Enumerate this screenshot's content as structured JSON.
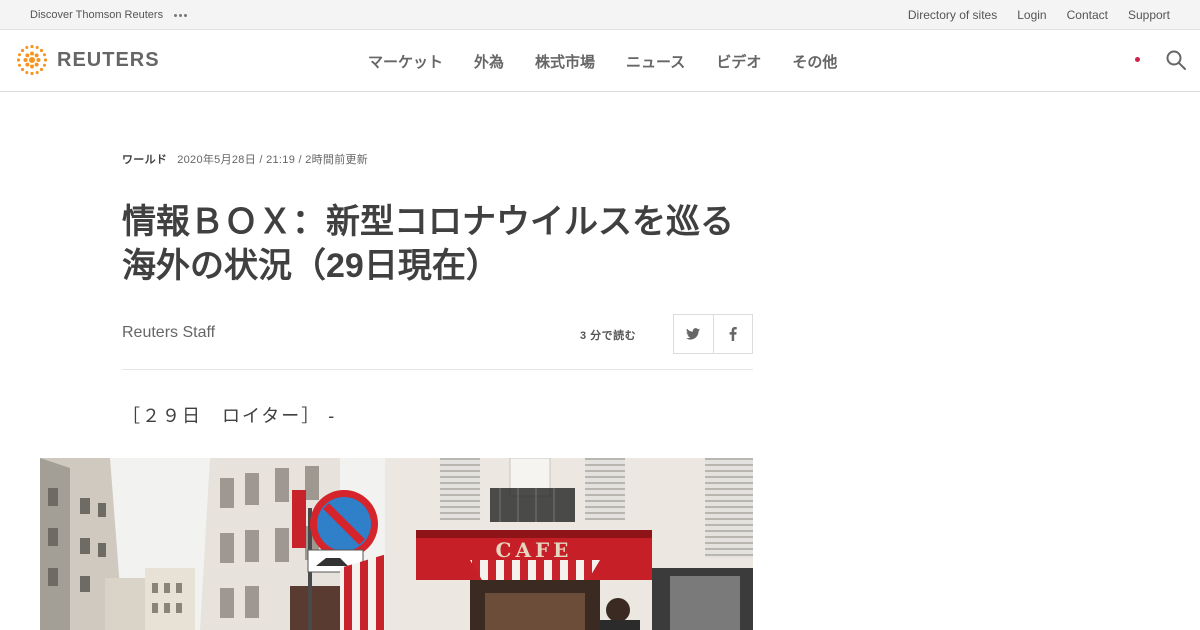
{
  "utility_bar": {
    "discover": "Discover Thomson Reuters",
    "links": [
      "Directory of sites",
      "Login",
      "Contact",
      "Support"
    ]
  },
  "header": {
    "logo_text": "REUTERS",
    "nav": [
      "マーケット",
      "外為",
      "株式市場",
      "ニュース",
      "ビデオ",
      "その他"
    ],
    "region_icon": "japan-flag-icon",
    "search_icon": "search-icon"
  },
  "article": {
    "category": "ワールド",
    "timestamp": "2020年5月28日 / 21:19 / 2時間前更新",
    "headline": "情報ＢＯＸ：新型コロナウイルスを巡る海外の状況（29日現在）",
    "byline": "Reuters Staff",
    "read_time": "3 分で読む",
    "share_icons": [
      "twitter-icon",
      "facebook-icon"
    ],
    "dateline": "［２９日　ロイター］ -"
  },
  "photo": {
    "sign_text": "CAFE"
  },
  "colors": {
    "brand_orange": "#f7941d",
    "text": "#404040",
    "flag_red": "#d0234b"
  }
}
